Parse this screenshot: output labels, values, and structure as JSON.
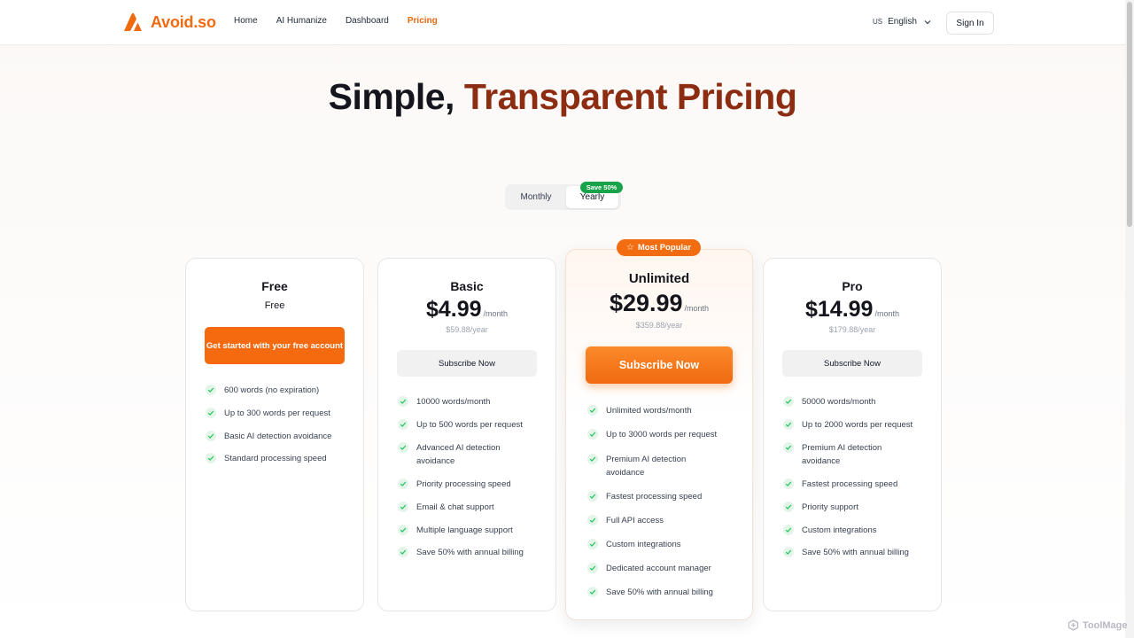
{
  "brand": {
    "name": "Avoid.so",
    "color": "#f06a0f"
  },
  "nav": {
    "items": [
      {
        "label": "Home",
        "active": false
      },
      {
        "label": "AI Humanize",
        "active": false
      },
      {
        "label": "Dashboard",
        "active": false
      },
      {
        "label": "Pricing",
        "active": true
      }
    ],
    "language": {
      "flag": "US",
      "label": "English"
    },
    "sign_in": "Sign In"
  },
  "hero": {
    "title_part1": "Simple,",
    "title_part2": "Transparent Pricing"
  },
  "billing_toggle": {
    "monthly": "Monthly",
    "yearly": "Yearly",
    "selected": "Yearly",
    "badge": "Save 50%"
  },
  "plans": {
    "free": {
      "name": "Free",
      "subtitle": "Free",
      "button": "Get started with your free account",
      "features": [
        "600 words (no expiration)",
        "Up to 300 words per request",
        "Basic AI detection avoidance",
        "Standard processing speed"
      ]
    },
    "basic": {
      "name": "Basic",
      "price": "$4.99",
      "per": "/month",
      "yearly": "$59.88/year",
      "button": "Subscribe Now",
      "features": [
        "10000 words/month",
        "Up to 500 words per request",
        "Advanced AI detection avoidance",
        "Priority processing speed",
        "Email & chat support",
        "Multiple language support",
        "Save 50% with annual billing"
      ]
    },
    "unlimited": {
      "badge": "Most Popular",
      "name": "Unlimited",
      "price": "$29.99",
      "per": "/month",
      "yearly": "$359.88/year",
      "button": "Subscribe Now",
      "features": [
        "Unlimited words/month",
        "Up to 3000 words per request",
        "Premium AI detection avoidance",
        "Fastest processing speed",
        "Full API access",
        "Custom integrations",
        "Dedicated account manager",
        "Save 50% with annual billing"
      ]
    },
    "pro": {
      "name": "Pro",
      "price": "$14.99",
      "per": "/month",
      "yearly": "$179.88/year",
      "button": "Subscribe Now",
      "features": [
        "50000 words/month",
        "Up to 2000 words per request",
        "Premium AI detection avoidance",
        "Fastest processing speed",
        "Priority support",
        "Custom integrations",
        "Save 50% with annual billing"
      ]
    }
  },
  "watermark": "ToolMage",
  "colors": {
    "accent": "#f26c10",
    "title_dark": "#15161d",
    "title_accent": "#8c2d12",
    "check_green": "#22c55e",
    "badge_green": "#16a34a"
  }
}
